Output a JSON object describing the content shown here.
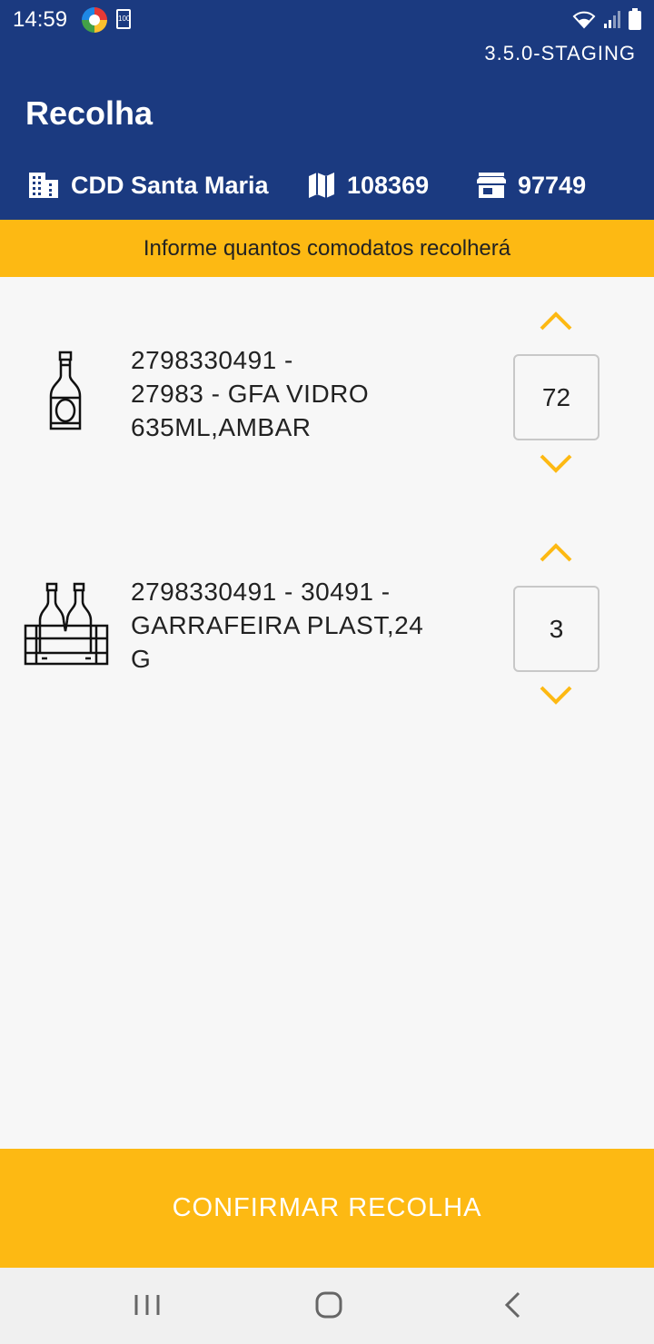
{
  "status_bar": {
    "time": "14:59",
    "battery_saver_label": "100"
  },
  "header": {
    "version": "3.5.0-STAGING",
    "title": "Recolha",
    "distribution_center": "CDD Santa Maria",
    "map_code": "108369",
    "store_code": "97749"
  },
  "banner": {
    "text": "Informe quantos comodatos recolherá"
  },
  "items": [
    {
      "lines": [
        "2798330491 -",
        "27983 - GFA VIDRO",
        "635ML,AMBAR"
      ],
      "quantity": "72",
      "icon": "bottle-icon"
    },
    {
      "lines": [
        "2798330491 - 30491 -",
        "GARRAFEIRA PLAST,24",
        "G"
      ],
      "quantity": "3",
      "icon": "bottle-crate-icon"
    }
  ],
  "confirm_button": {
    "label": "CONFIRMAR RECOLHA"
  },
  "colors": {
    "header_bg": "#1b3a80",
    "accent": "#fdb913",
    "background": "#f7f7f7"
  }
}
